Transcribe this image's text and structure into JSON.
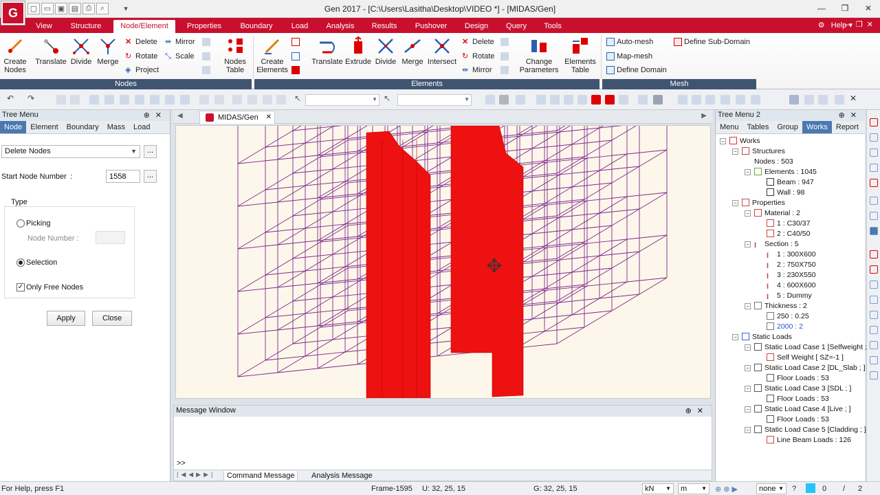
{
  "window": {
    "title": "Gen 2017 - [C:\\Users\\Lasitha\\Desktop\\VIDEO *] - [MIDAS/Gen]",
    "logo": "G"
  },
  "menu": {
    "tabs": [
      "View",
      "Structure",
      "Node/Element",
      "Properties",
      "Boundary",
      "Load",
      "Analysis",
      "Results",
      "Pushover",
      "Design",
      "Query",
      "Tools"
    ],
    "active": "Node/Element",
    "help": "Help"
  },
  "ribbon": {
    "nodes": {
      "label": "Nodes",
      "create": "Create\nNodes",
      "translate": "Translate",
      "divide": "Divide",
      "merge": "Merge",
      "delete": "Delete",
      "rotate": "Rotate",
      "project": "Project",
      "mirror": "Mirror",
      "scale": "Scale",
      "table": "Nodes\nTable"
    },
    "elements": {
      "label": "Elements",
      "create": "Create\nElements",
      "translate": "Translate",
      "extrude": "Extrude",
      "divide": "Divide",
      "merge": "Merge",
      "intersect": "Intersect",
      "delete": "Delete",
      "rotate": "Rotate",
      "mirror": "Mirror",
      "change": "Change\nParameters",
      "table": "Elements\nTable"
    },
    "mesh": {
      "label": "Mesh",
      "auto": "Auto-mesh",
      "map": "Map-mesh",
      "domain": "Define Domain",
      "subdomain": "Define Sub-Domain"
    }
  },
  "left_panel": {
    "title": "Tree Menu",
    "tabs": [
      "Node",
      "Element",
      "Boundary",
      "Mass",
      "Load"
    ],
    "active_tab": "Node",
    "function": "Delete Nodes",
    "start_node_label": "Start Node Number",
    "start_node_colon": ":",
    "start_node_value": "1558",
    "type_label": "Type",
    "picking": "Picking",
    "node_number": "Node Number :",
    "selection": "Selection",
    "only_free": "Only Free Nodes",
    "apply": "Apply",
    "close": "Close"
  },
  "viewport": {
    "tab": "MIDAS/Gen"
  },
  "message": {
    "title": "Message Window",
    "prompt": ">>",
    "tabs": [
      "Command Message",
      "Analysis Message"
    ]
  },
  "right_panel": {
    "title": "Tree Menu 2",
    "tabs": [
      "Menu",
      "Tables",
      "Group",
      "Works",
      "Report"
    ],
    "active_tab": "Works",
    "tree": [
      {
        "t": "Works",
        "lvl": 0,
        "ic": "works"
      },
      {
        "t": "Structures",
        "lvl": 1,
        "ic": "struct"
      },
      {
        "t": "Nodes : 503",
        "lvl": 2,
        "ic": "none"
      },
      {
        "t": "Elements : 1045",
        "lvl": 2,
        "ic": "elem"
      },
      {
        "t": "Beam : 947",
        "lvl": 3,
        "ic": "beam"
      },
      {
        "t": "Wall : 98",
        "lvl": 3,
        "ic": "beam"
      },
      {
        "t": "Properties",
        "lvl": 1,
        "ic": "prop"
      },
      {
        "t": "Material : 2",
        "lvl": 2,
        "ic": "mat"
      },
      {
        "t": "1 : C30/37",
        "lvl": 3,
        "ic": "mat"
      },
      {
        "t": "2 : C40/50",
        "lvl": 3,
        "ic": "mat"
      },
      {
        "t": "Section : 5",
        "lvl": 2,
        "ic": "sec"
      },
      {
        "t": "1 : 300X600",
        "lvl": 3,
        "ic": "sec"
      },
      {
        "t": "2 : 750X750",
        "lvl": 3,
        "ic": "sec"
      },
      {
        "t": "3 : 230X550",
        "lvl": 3,
        "ic": "sec"
      },
      {
        "t": "4 : 600X600",
        "lvl": 3,
        "ic": "sec"
      },
      {
        "t": "5 : Dummy",
        "lvl": 3,
        "ic": "sec"
      },
      {
        "t": "Thickness : 2",
        "lvl": 2,
        "ic": "thk"
      },
      {
        "t": "250 : 0.25",
        "lvl": 3,
        "ic": "thk"
      },
      {
        "t": "2000 : 2",
        "lvl": 3,
        "ic": "thk",
        "sel": true
      },
      {
        "t": "Static Loads",
        "lvl": 1,
        "ic": "load"
      },
      {
        "t": "Static Load Case 1 [Selfweight ; ]",
        "lvl": 2,
        "ic": "lc"
      },
      {
        "t": "Self Weight [ SZ=-1 ]",
        "lvl": 3,
        "ic": "sw"
      },
      {
        "t": "Static Load Case 2 [DL_Slab ; ]",
        "lvl": 2,
        "ic": "lc"
      },
      {
        "t": "Floor Loads : 53",
        "lvl": 3,
        "ic": "fl"
      },
      {
        "t": "Static Load Case 3 [SDL ; ]",
        "lvl": 2,
        "ic": "lc"
      },
      {
        "t": "Floor Loads : 53",
        "lvl": 3,
        "ic": "fl"
      },
      {
        "t": "Static Load Case 4 [Live ; ]",
        "lvl": 2,
        "ic": "lc"
      },
      {
        "t": "Floor Loads : 53",
        "lvl": 3,
        "ic": "fl"
      },
      {
        "t": "Static Load Case 5 [Cladding ; ]",
        "lvl": 2,
        "ic": "lc"
      },
      {
        "t": "Line Beam Loads : 126",
        "lvl": 3,
        "ic": "lb"
      }
    ]
  },
  "status": {
    "help": "For Help, press F1",
    "frame": "Frame-1595",
    "u": "U: 32, 25, 15",
    "g": "G: 32, 25, 15",
    "force": "kN",
    "length": "m",
    "none": "none",
    "page_a": "0",
    "sep": "/",
    "page_b": "2"
  },
  "colors": {
    "accent": "#c8102e",
    "wall": "#ee1111",
    "frame": "#7b2a8c",
    "viewport_bg": "#fdf6ea"
  }
}
